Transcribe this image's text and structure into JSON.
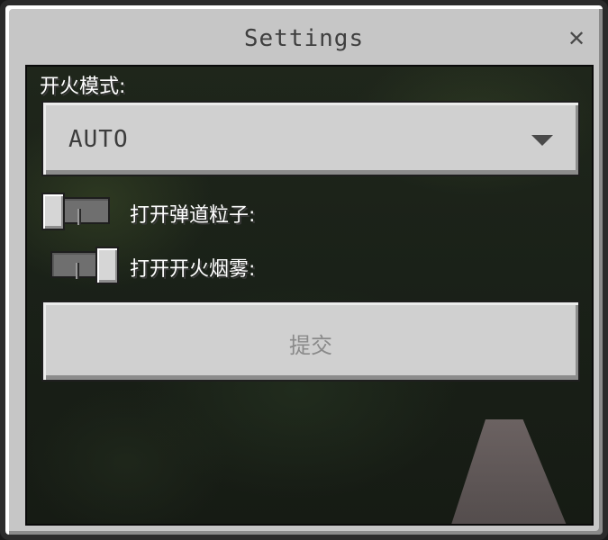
{
  "window": {
    "title": "Settings",
    "close_icon": "close-icon"
  },
  "fire_mode": {
    "label": "开火模式:",
    "selected": "AUTO",
    "arrow_icon": "triangle-down-icon"
  },
  "toggles": [
    {
      "label": "打开弹道粒子:",
      "enabled": false
    },
    {
      "label": "打开开火烟雾:",
      "enabled": true
    }
  ],
  "submit": {
    "label": "提交"
  },
  "colors": {
    "panel": "#c6c6c6",
    "button": "#d0d0d0",
    "background": "#1a2118"
  }
}
